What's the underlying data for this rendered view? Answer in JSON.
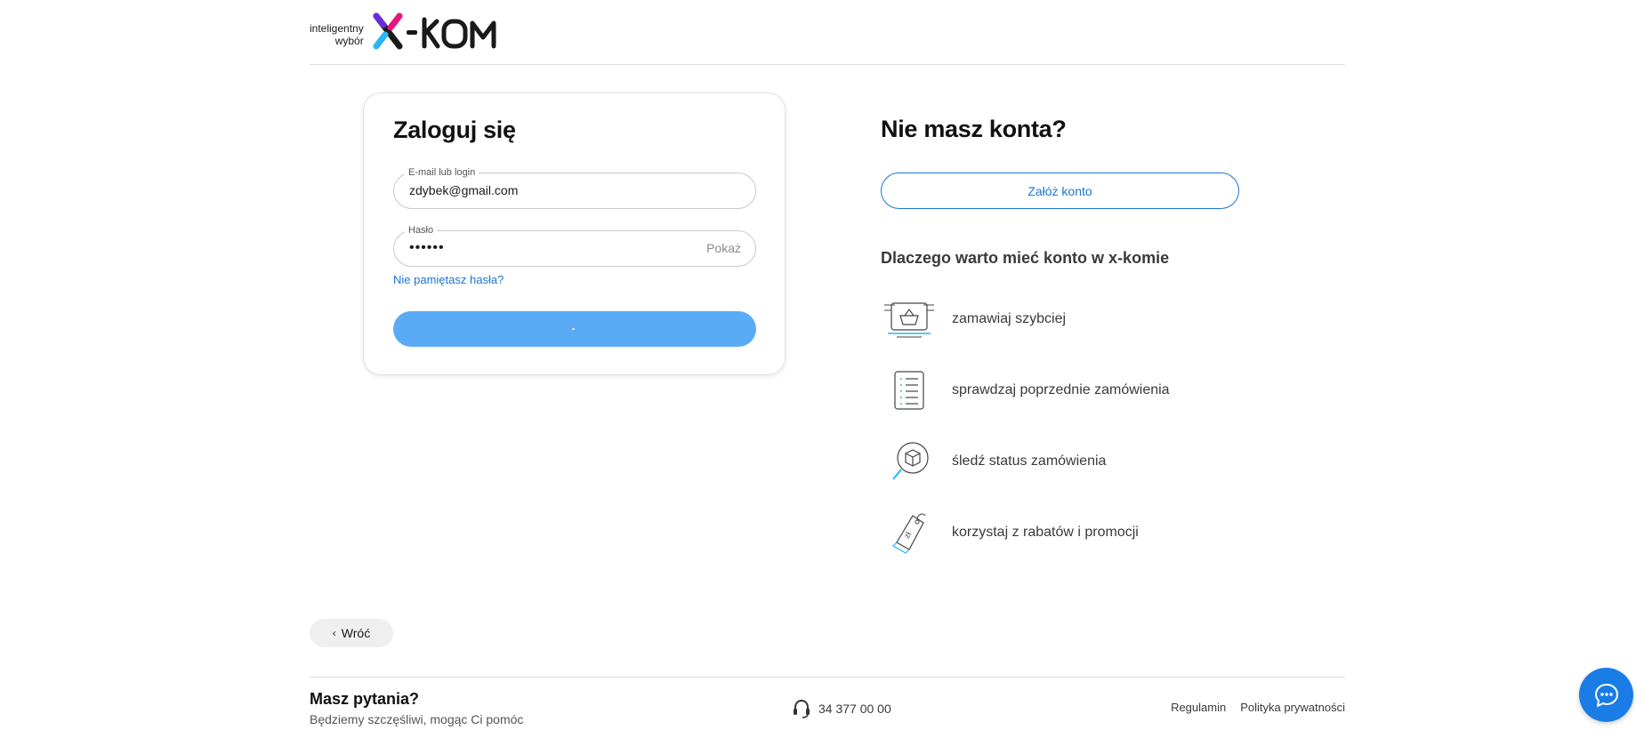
{
  "header": {
    "tagline_line1": "inteligentny",
    "tagline_line2": "wybór",
    "logo_text": "x-kom"
  },
  "login": {
    "title": "Zaloguj się",
    "email_label": "E-mail lub login",
    "email_value": "zdybek@gmail.com",
    "password_label": "Hasło",
    "password_value": "••••••",
    "show_password": "Pokaż",
    "forgot_password": "Nie pamiętasz hasła?"
  },
  "register": {
    "title": "Nie masz konta?",
    "button": "Załóż konto",
    "why_title": "Dlaczego warto mieć konto w x-komie",
    "benefits": [
      {
        "icon": "basket-icon",
        "text": "zamawiaj szybciej"
      },
      {
        "icon": "list-icon",
        "text": "sprawdzaj poprzednie zamówienia"
      },
      {
        "icon": "package-search-icon",
        "text": "śledź status zamówienia"
      },
      {
        "icon": "price-tag-icon",
        "text": "korzystaj z rabatów i promocji"
      }
    ]
  },
  "back": {
    "label": "Wróć"
  },
  "footer": {
    "question": "Masz pytania?",
    "subtitle": "Będziemy szczęśliwi, mogąc Ci pomóc",
    "phone": "34 377 00 00",
    "link_terms": "Regulamin",
    "link_privacy": "Polityka prywatności"
  },
  "colors": {
    "accent": "#1a76d2",
    "submit_button": "#5aabf5",
    "chat_button": "#1a7de6"
  }
}
